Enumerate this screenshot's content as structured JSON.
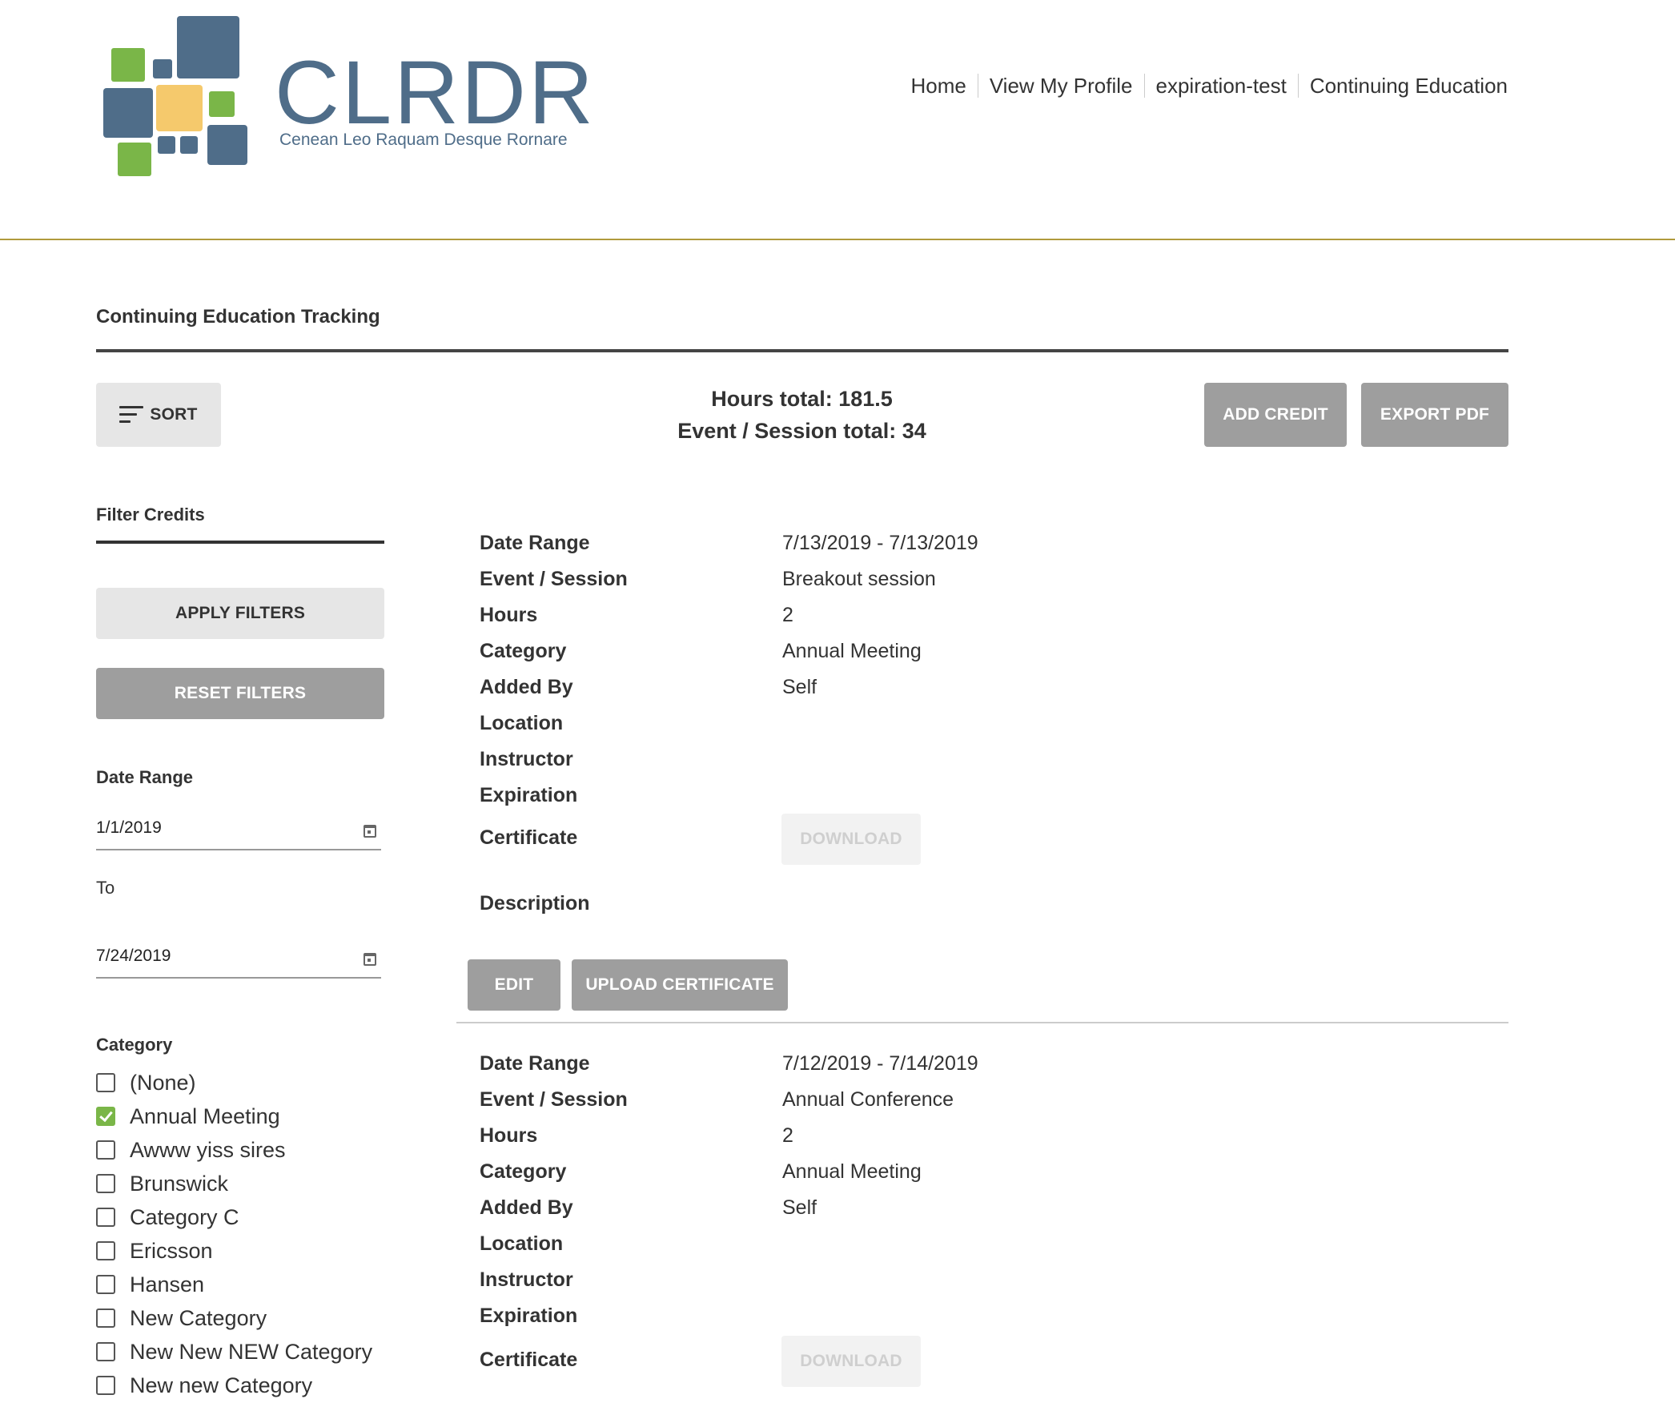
{
  "brand": {
    "logo_text": "CLRDR",
    "tagline": "Cenean Leo Raquam Desque Rornare",
    "colors": {
      "blue": "#4f6d89",
      "green": "#7ab648",
      "yellow": "#f5c96c",
      "rule": "#b09a3c"
    }
  },
  "nav": {
    "items": [
      {
        "label": "Home"
      },
      {
        "label": "View My Profile"
      },
      {
        "label": "expiration-test"
      },
      {
        "label": "Continuing Education"
      }
    ]
  },
  "page": {
    "title": "Continuing Education Tracking"
  },
  "toolbar": {
    "sort_label": "SORT",
    "sort_icon": "sort-icon",
    "hours_total": "Hours total: 181.5",
    "event_total": "Event / Session total: 34",
    "add_credit_label": "ADD CREDIT",
    "export_pdf_label": "EXPORT PDF"
  },
  "filters": {
    "title": "Filter Credits",
    "apply_label": "APPLY FILTERS",
    "reset_label": "RESET FILTERS",
    "date_range_label": "Date Range",
    "date_from": "1/1/2019",
    "to_label": "To",
    "date_to": "7/24/2019",
    "calendar_icon": "calendar-icon",
    "category_label": "Category",
    "categories": [
      {
        "label": "(None)",
        "checked": false
      },
      {
        "label": "Annual Meeting",
        "checked": true
      },
      {
        "label": "Awww yiss sires",
        "checked": false
      },
      {
        "label": "Brunswick",
        "checked": false
      },
      {
        "label": "Category C",
        "checked": false
      },
      {
        "label": "Ericsson",
        "checked": false
      },
      {
        "label": "Hansen",
        "checked": false
      },
      {
        "label": "New Category",
        "checked": false
      },
      {
        "label": "New New NEW Category",
        "checked": false
      },
      {
        "label": "New new Category",
        "checked": false
      }
    ]
  },
  "field_labels": {
    "date_range": "Date Range",
    "event": "Event / Session",
    "hours": "Hours",
    "category": "Category",
    "added_by": "Added By",
    "location": "Location",
    "instructor": "Instructor",
    "expiration": "Expiration",
    "certificate": "Certificate",
    "description": "Description"
  },
  "actions": {
    "download_label": "DOWNLOAD",
    "edit_label": "EDIT",
    "upload_label": "UPLOAD CERTIFICATE"
  },
  "records": [
    {
      "date_range": "7/13/2019 - 7/13/2019",
      "event": "Breakout session",
      "hours": "2",
      "category": "Annual Meeting",
      "added_by": "Self",
      "location": "",
      "instructor": "",
      "expiration": "",
      "description": ""
    },
    {
      "date_range": "7/12/2019 - 7/14/2019",
      "event": "Annual Conference",
      "hours": "2",
      "category": "Annual Meeting",
      "added_by": "Self",
      "location": "",
      "instructor": "",
      "expiration": ""
    }
  ]
}
